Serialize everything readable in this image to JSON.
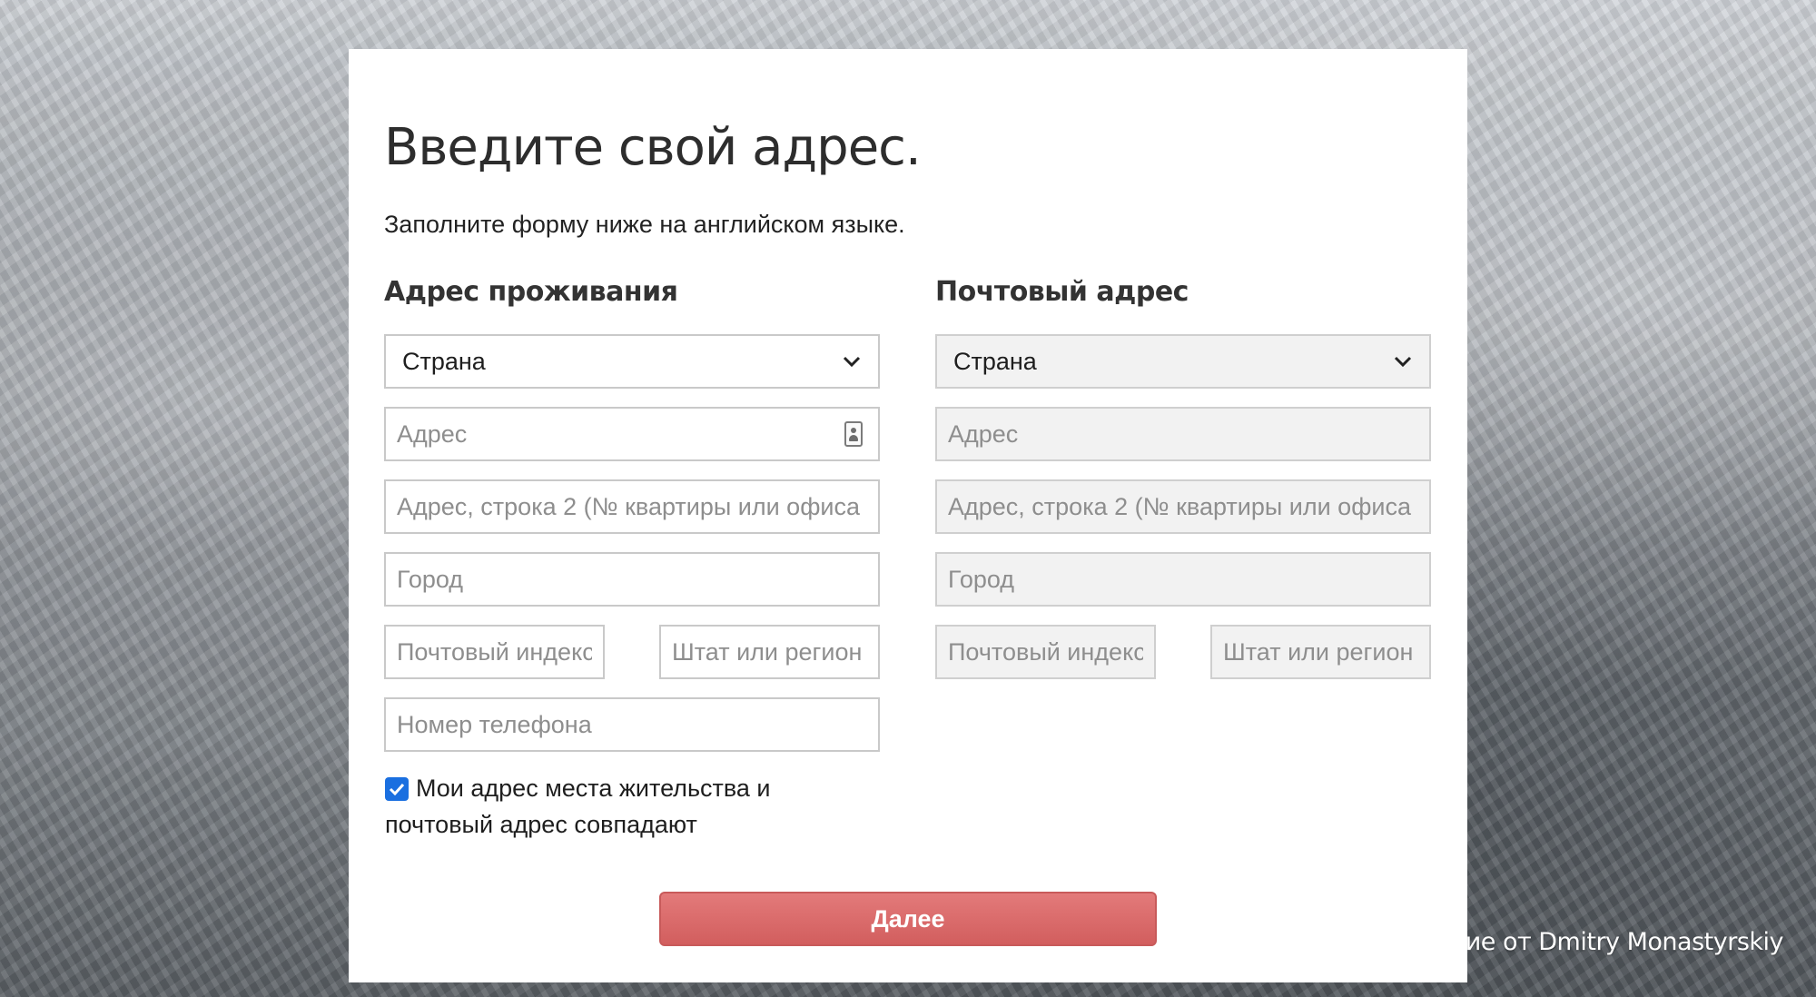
{
  "page": {
    "title": "Введите свой адрес.",
    "subtitle": "Заполните форму ниже на английском языке.",
    "credit": "жение от Dmitry Monastyrskiy"
  },
  "residential": {
    "heading": "Адрес проживания",
    "country": "Страна",
    "address_placeholder": "Адрес",
    "address2_placeholder": "Адрес, строка 2 (№ квартиры или офиса",
    "city_placeholder": "Город",
    "zip_placeholder": "Почтовый индекс",
    "state_placeholder": "Штат или регион",
    "phone_placeholder": "Номер телефона"
  },
  "mailing": {
    "heading": "Почтовый адрес",
    "country": "Страна",
    "address_placeholder": "Адрес",
    "address2_placeholder": "Адрес, строка 2 (№ квартиры или офиса",
    "city_placeholder": "Город",
    "zip_placeholder": "Почтовый индекс",
    "state_placeholder": "Штат или регион"
  },
  "same_address": {
    "label": "Мои адрес места жительства и почтовый адрес совпадают",
    "checked": true
  },
  "next_button": "Далее",
  "colors": {
    "button": "#d86666",
    "checkbox": "#1a6fe0"
  },
  "icons": {
    "dropdown": "chevron-down-icon",
    "autofill": "contact-card-icon",
    "checkbox": "checkmark-icon"
  }
}
